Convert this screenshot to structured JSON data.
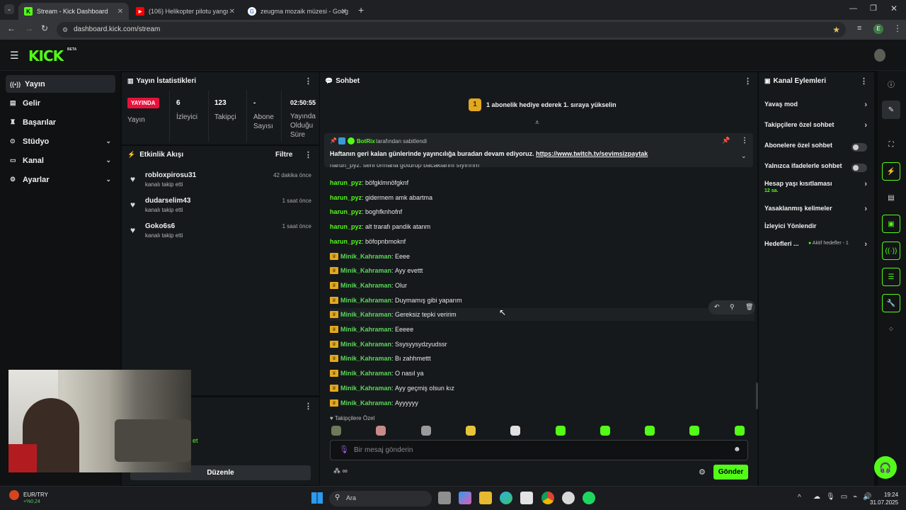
{
  "browser": {
    "tabs": [
      {
        "title": "Stream - Kick Dashboard",
        "active": true
      },
      {
        "title": "(106) Helikopter pilotu yangına",
        "active": false
      },
      {
        "title": "zeugma mozaik müzesi - Goog",
        "active": false
      }
    ],
    "url": "dashboard.kick.com/stream",
    "profile_initial": "E"
  },
  "kick": {
    "logo": "KICK",
    "beta": "BETA"
  },
  "sidebar": {
    "items": [
      {
        "label": "Yayın",
        "icon": "broadcast-icon"
      },
      {
        "label": "Gelir",
        "icon": "wallet-icon"
      },
      {
        "label": "Başarılar",
        "icon": "trophy-icon"
      },
      {
        "label": "Stüdyo",
        "icon": "studio-icon"
      },
      {
        "label": "Kanal",
        "icon": "channel-icon"
      },
      {
        "label": "Ayarlar",
        "icon": "gear-icon"
      }
    ]
  },
  "stats": {
    "title": "Yayın İstatistikleri",
    "live_badge": "YAYINDA",
    "live_label": "Yayın",
    "viewers_value": "6",
    "viewers_label": "İzleyici",
    "followers_value": "123",
    "followers_label": "Takipçi",
    "subs_value": "-",
    "subs_label_1": "Abone",
    "subs_label_2": "Sayısı",
    "uptime_value": "02:50:55",
    "uptime_label_1": "Yayında",
    "uptime_label_2": "Olduğu",
    "uptime_label_3": "Süre"
  },
  "activity": {
    "title": "Etkinlik Akışı",
    "filter": "Filtre",
    "items": [
      {
        "name": "robloxpirosu31",
        "sub": "kanalı takip etti",
        "time": "42 dakika önce"
      },
      {
        "name": "dudarselim43",
        "sub": "kanalı takip etti",
        "time": "1 saat önce"
      },
      {
        "name": "Goko6s6",
        "sub": "kanalı takip etti",
        "time": "1 saat önce"
      }
    ]
  },
  "bottom_panel": {
    "partial_text": "et",
    "edit_button": "Düzenle"
  },
  "chat": {
    "title": "Sohbet",
    "gift_rank": "1",
    "gift_text": "1 abonelik hediye ederek 1. sıraya yükselin",
    "pinned": {
      "by_user": "BotRix",
      "by_text": "tarafından sabitlendi",
      "text": "Haftanın geri kalan günlerinde yayıncılığa buradan devam ediyoruz.",
      "link": "https://www.twitch.tv/sevimsizpaytak"
    },
    "cut_line": "harun_pyz: seni ormana götürüp bacaklarını sıyırırım",
    "messages": [
      {
        "user": "harun_pyz",
        "text": "böfgklmnöfgknf",
        "crown": false
      },
      {
        "user": "harun_pyz",
        "text": "gidermem amk abartma",
        "crown": false
      },
      {
        "user": "harun_pyz",
        "text": "boghfknhofnf",
        "crown": false
      },
      {
        "user": "harun_pyz",
        "text": "alt trarafı pandik atanm",
        "crown": false
      },
      {
        "user": "harun_pyz",
        "text": "böfopnbmoknf",
        "crown": false
      },
      {
        "user": "Minik_Kahraman",
        "text": "Eeee",
        "crown": true
      },
      {
        "user": "Minik_Kahraman",
        "text": "Ayy evettt",
        "crown": true
      },
      {
        "user": "Minik_Kahraman",
        "text": "Olur",
        "crown": true
      },
      {
        "user": "Minik_Kahraman",
        "text": "Duymamış gibi yaparım",
        "crown": true
      },
      {
        "user": "Minik_Kahraman",
        "text": "Gereksiz tepki veririm",
        "crown": true
      },
      {
        "user": "Minik_Kahraman",
        "text": "Eeeee",
        "crown": true
      },
      {
        "user": "Minik_Kahraman",
        "text": "Ssysyysydzyudssr",
        "crown": true
      },
      {
        "user": "Minik_Kahraman",
        "text": "Bı zahhmettt",
        "crown": true
      },
      {
        "user": "Minik_Kahraman",
        "text": "O nasıl ya",
        "crown": true
      },
      {
        "user": "Minik_Kahraman",
        "text": "Ayy geçmiş olsun kız",
        "crown": true
      },
      {
        "user": "Minik_Kahraman",
        "text": "Ayyyyyy",
        "crown": true
      }
    ],
    "followers_only_label": "Takipçilere Özel",
    "input_placeholder": "Bir mesaj gönderin",
    "send": "Gönder"
  },
  "channel_actions": {
    "title": "Kanal Eylemleri",
    "items": [
      {
        "label": "Yavaş mod",
        "kind": "arrow"
      },
      {
        "label": "Takipçilere özel sohbet",
        "kind": "arrow"
      },
      {
        "label": "Abonelere özel sohbet",
        "kind": "toggle",
        "on": false
      },
      {
        "label": "Yalnızca ifadelerle sohbet",
        "kind": "toggle",
        "on": false
      },
      {
        "label": "Hesap yaşı kısıtlaması",
        "kind": "arrow",
        "sub": "12 sa."
      },
      {
        "label": "Yasaklanmış kelimeler",
        "kind": "arrow"
      },
      {
        "label": "İzleyici Yönlendir",
        "kind": "none"
      },
      {
        "label": "Hedefleri ...",
        "kind": "arrow",
        "sub": "Aktif hedefler - 1"
      }
    ]
  },
  "taskbar": {
    "ticker_name": "EUR/TRY",
    "ticker_change": "+%0,24",
    "search": "Ara",
    "time": "19:24",
    "date": "31.07.2025"
  },
  "colors": {
    "accent": "#53fc18",
    "live": "#e9113c",
    "crown": "#e2a820"
  }
}
